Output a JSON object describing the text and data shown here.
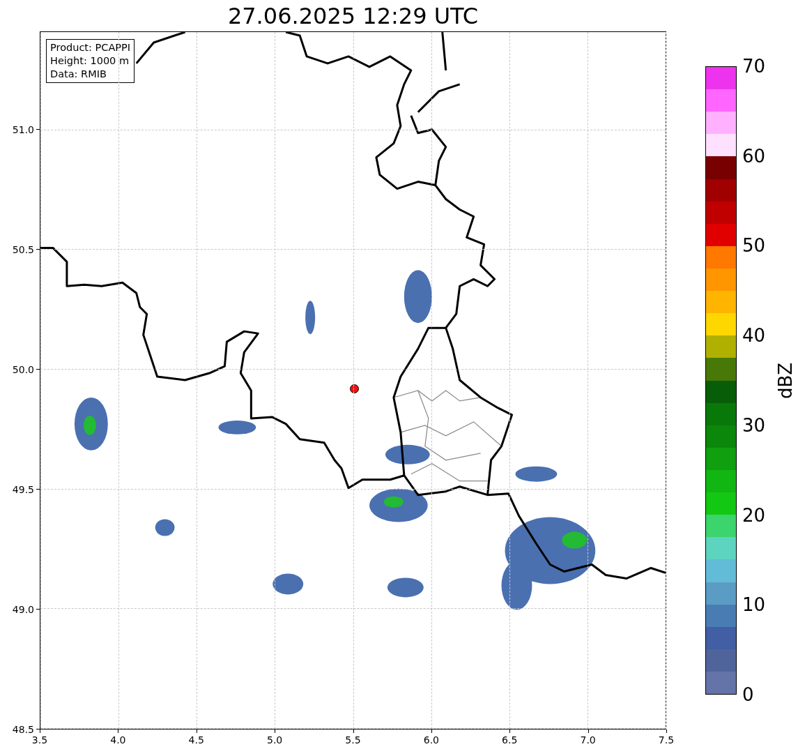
{
  "title": "27.06.2025 12:29 UTC",
  "info_box": {
    "lines": [
      "Product: PCAPPI",
      "Height: 1000 m",
      "Data: RMIB"
    ]
  },
  "x_ticks": [
    "3.5",
    "4.0",
    "4.5",
    "5.0",
    "5.5",
    "6.0",
    "6.5",
    "7.0",
    "7.5"
  ],
  "y_ticks": [
    "51.0",
    "50.5",
    "50.0",
    "49.5",
    "49.0",
    "48.5"
  ],
  "colorbar": {
    "label": "dBZ",
    "ticks": [
      "70",
      "60",
      "50",
      "40",
      "30",
      "20",
      "10",
      "0"
    ],
    "segments": [
      {
        "color": "#ee33ee"
      },
      {
        "color": "#ff66ff"
      },
      {
        "color": "#ffb0ff"
      },
      {
        "color": "#ffe0ff"
      },
      {
        "color": "#780000"
      },
      {
        "color": "#a00000"
      },
      {
        "color": "#c00000"
      },
      {
        "color": "#e00000"
      },
      {
        "color": "#ff7800"
      },
      {
        "color": "#ff9600"
      },
      {
        "color": "#ffb400"
      },
      {
        "color": "#ffd700"
      },
      {
        "color": "#b0b000"
      },
      {
        "color": "#487808"
      },
      {
        "color": "#085e08"
      },
      {
        "color": "#087808"
      },
      {
        "color": "#0b870b"
      },
      {
        "color": "#0f9f0f"
      },
      {
        "color": "#12b612"
      },
      {
        "color": "#12c812"
      },
      {
        "color": "#3cd46c"
      },
      {
        "color": "#5cd4c0"
      },
      {
        "color": "#62bcd8"
      },
      {
        "color": "#5a9cc4"
      },
      {
        "color": "#4a7cb4"
      },
      {
        "color": "#425ea4"
      },
      {
        "color": "#50649c"
      },
      {
        "color": "#6474a8"
      }
    ]
  }
}
